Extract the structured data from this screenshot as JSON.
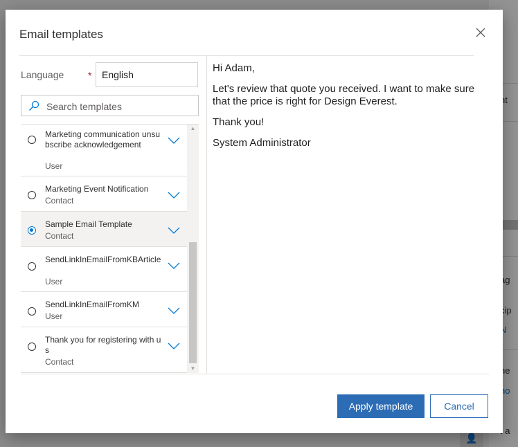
{
  "dialog": {
    "title": "Email templates",
    "close_label": "✕"
  },
  "language": {
    "label": "Language",
    "required_marker": "*",
    "value": "English"
  },
  "search": {
    "placeholder": "Search templates"
  },
  "templates": [
    {
      "name": "Marketing communication unsubscribe acknowledgement",
      "type": "User",
      "selected": false
    },
    {
      "name": "Marketing Event Notification",
      "type": "Contact",
      "selected": false
    },
    {
      "name": "Sample Email Template",
      "type": "Contact",
      "selected": true
    },
    {
      "name": "SendLinkInEmailFromKBArticle",
      "type": "User",
      "selected": false
    },
    {
      "name": "SendLinkInEmailFromKM",
      "type": "User",
      "selected": false
    },
    {
      "name": "Thank you for registering with us",
      "type": "Contact",
      "selected": false
    }
  ],
  "preview": {
    "greeting": "Hi Adam,",
    "body": "Let's review that quote you received. I want to make sure that the price is right for Design Everest.",
    "closing": "Thank you!",
    "signature": "System Administrator"
  },
  "footer": {
    "apply_label": "Apply template",
    "cancel_label": "Cancel"
  },
  "background_fragments": {
    "frag1": "nt",
    "frag2": "ag",
    "frag3": "cip",
    "frag4": "N",
    "frag5": "ne",
    "frag6": "no",
    "frag7": "t a"
  },
  "colors": {
    "accent": "#2b6cb5",
    "radio_selected": "#0078d4",
    "selected_row": "#f3f2f1"
  }
}
